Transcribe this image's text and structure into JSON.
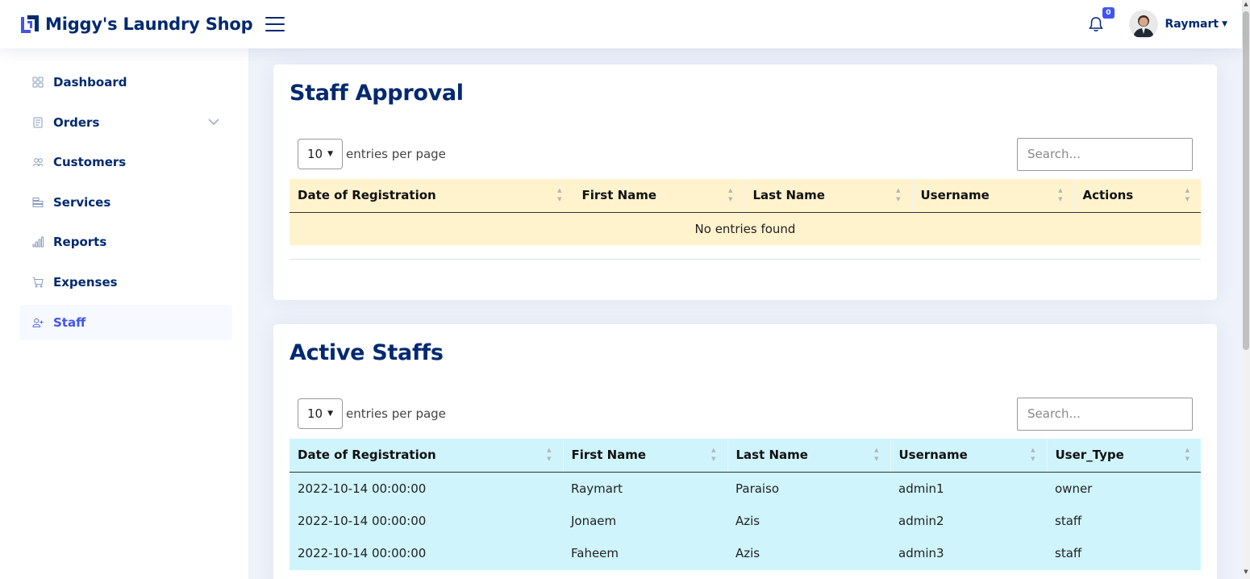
{
  "brand": {
    "name": "Miggy's Laundry Shop"
  },
  "header": {
    "notification_count": "0",
    "user_name": "Raymart"
  },
  "sidebar": {
    "items": [
      {
        "label": "Dashboard",
        "icon": "grid-icon"
      },
      {
        "label": "Orders",
        "icon": "receipt-icon"
      },
      {
        "label": "Customers",
        "icon": "people-icon"
      },
      {
        "label": "Services",
        "icon": "layers-icon"
      },
      {
        "label": "Reports",
        "icon": "bar-chart-icon"
      },
      {
        "label": "Expenses",
        "icon": "cart-icon"
      },
      {
        "label": "Staff",
        "icon": "person-plus-icon",
        "active": true
      }
    ]
  },
  "staff_approval": {
    "title": "Staff Approval",
    "page_size": "10",
    "entries_label": "entries per page",
    "search_placeholder": "Search...",
    "columns": [
      "Date of Registration",
      "First Name",
      "Last Name",
      "Username",
      "Actions"
    ],
    "empty_message": "No entries found"
  },
  "active_staffs": {
    "title": "Active Staffs",
    "page_size": "10",
    "entries_label": "entries per page",
    "search_placeholder": "Search...",
    "columns": [
      "Date of Registration",
      "First Name",
      "Last Name",
      "Username",
      "User_Type"
    ],
    "rows": [
      [
        "2022-10-14 00:00:00",
        "Raymart",
        "Paraiso",
        "admin1",
        "owner"
      ],
      [
        "2022-10-14 00:00:00",
        "Jonaem",
        "Azis",
        "admin2",
        "staff"
      ],
      [
        "2022-10-14 00:00:00",
        "Faheem",
        "Azis",
        "admin3",
        "staff"
      ]
    ]
  },
  "colors": {
    "brand": "#012970",
    "accent": "#4154f1",
    "approval_table_bg": "#fff3cd",
    "active_table_bg": "#cff4fc"
  }
}
